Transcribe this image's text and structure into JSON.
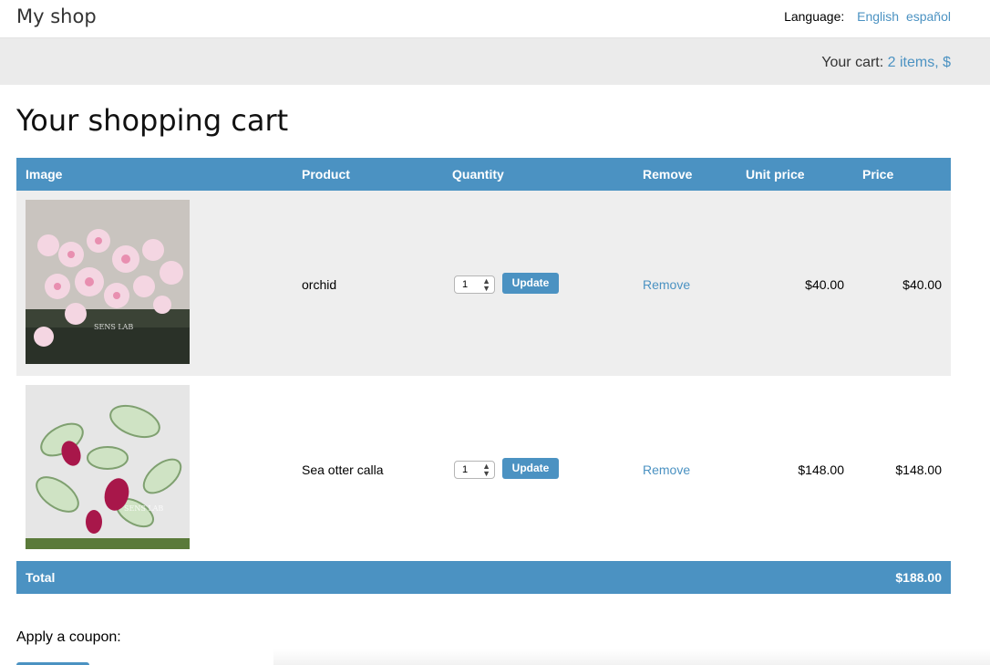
{
  "header": {
    "logo": "My shop",
    "language_label": "Language:",
    "languages": [
      "English",
      "español"
    ]
  },
  "cartbar": {
    "label": "Your cart:",
    "summary": "2 items, $"
  },
  "page_title": "Your shopping cart",
  "table": {
    "columns": [
      "Image",
      "Product",
      "Quantity",
      "Remove",
      "Unit price",
      "Price"
    ],
    "rows": [
      {
        "product": "orchid",
        "quantity": "1",
        "update": "Update",
        "remove": "Remove",
        "unit_price": "$40.00",
        "price": "$40.00"
      },
      {
        "product": "Sea otter calla",
        "quantity": "1",
        "update": "Update",
        "remove": "Remove",
        "unit_price": "$148.00",
        "price": "$148.00"
      }
    ],
    "total_label": "Total",
    "total_value": "$188.00"
  },
  "coupon": {
    "label": "Apply a coupon:"
  },
  "colors": {
    "accent": "#4b92c2",
    "row_alt": "#eeeeee"
  }
}
